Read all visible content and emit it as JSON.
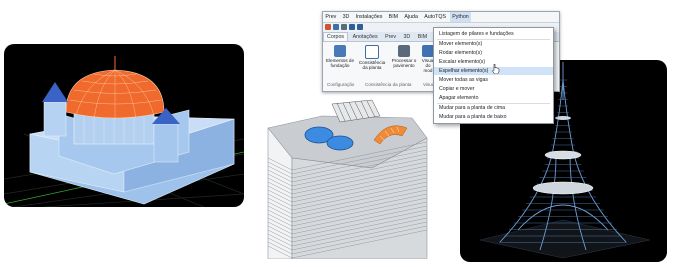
{
  "menubar": {
    "items": [
      "Prev",
      "3D",
      "Instalações",
      "BIM",
      "Ajuda",
      "AutoTQS",
      "Python"
    ],
    "active": "Python"
  },
  "ribbon": {
    "tabs": [
      "Corpos",
      "Anotações",
      "Prev",
      "3D",
      "BIM"
    ],
    "active_tab": "Corpos",
    "tools": [
      {
        "label": "Elementos de fundação",
        "icon": "foundation-elements-icon"
      },
      {
        "label": "Consistência da planta",
        "icon": "plan-consistency-icon"
      },
      {
        "label": "Processar o pavimento",
        "icon": "process-floor-icon"
      },
      {
        "label": "Visual do mod",
        "icon": "model-view-icon"
      }
    ],
    "groups": [
      "Configuração",
      "Consistência da planta",
      "Visual"
    ]
  },
  "python_menu": {
    "items": [
      "Listagem de pilares e fundações",
      "Mover elemento(s)",
      "Rodar elemento(s)",
      "Escalar elemento(s)",
      "Espelhar elemento(s)",
      "Mover todas as vigas",
      "Copiar e mover",
      "Apagar elemento",
      "Mudar para a planta de cima",
      "Mudar para a planta de baixo"
    ],
    "highlighted_index": 4
  },
  "colors": {
    "dome": "#ef6a2c",
    "building": "#a9c9ec",
    "roof_cones": "#3b63c6",
    "pool": "#3d8be0",
    "tower_wire": "#6fa0d6",
    "highlight": "#cfe2f7"
  }
}
